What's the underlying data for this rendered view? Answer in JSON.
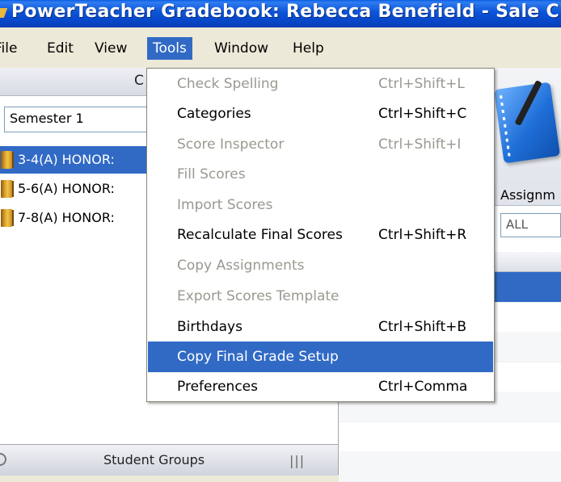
{
  "window": {
    "title": "PowerTeacher Gradebook: Rebecca Benefield - Sale C"
  },
  "menubar": {
    "items": [
      "File",
      "Edit",
      "View",
      "Tools",
      "Window",
      "Help"
    ],
    "active": "Tools"
  },
  "left_panel": {
    "header_label": "C",
    "term_select": "Semester 1",
    "sections": [
      {
        "label": "3-4(A) HONOR:",
        "selected": true
      },
      {
        "label": "5-6(A) HONOR:",
        "selected": false
      },
      {
        "label": "7-8(A) HONOR:",
        "selected": false
      }
    ],
    "bottom_tab": "Student Groups",
    "grip": "|||"
  },
  "right_area": {
    "assignments_label": "Assignm",
    "filter_value": "ALL"
  },
  "tools_menu": {
    "items": [
      {
        "label": "Check Spelling",
        "shortcut": "Ctrl+Shift+L",
        "enabled": false
      },
      {
        "label": "Categories",
        "shortcut": "Ctrl+Shift+C",
        "enabled": true
      },
      {
        "label": "Score Inspector",
        "shortcut": "Ctrl+Shift+I",
        "enabled": false
      },
      {
        "label": "Fill Scores",
        "shortcut": "",
        "enabled": false
      },
      {
        "label": "Import Scores",
        "shortcut": "",
        "enabled": false
      },
      {
        "label": "Recalculate Final Scores",
        "shortcut": "Ctrl+Shift+R",
        "enabled": true
      },
      {
        "label": "Copy Assignments",
        "shortcut": "",
        "enabled": false
      },
      {
        "label": "Export Scores Template",
        "shortcut": "",
        "enabled": false
      },
      {
        "label": "Birthdays",
        "shortcut": "Ctrl+Shift+B",
        "enabled": true
      },
      {
        "label": "Copy Final Grade Setup",
        "shortcut": "",
        "enabled": true,
        "highlighted": true
      },
      {
        "label": "Preferences",
        "shortcut": "Ctrl+Comma",
        "enabled": true
      }
    ]
  },
  "colors": {
    "title_bar": "#0b54d8",
    "selection": "#316ac5",
    "disabled_text": "#9a9890"
  }
}
